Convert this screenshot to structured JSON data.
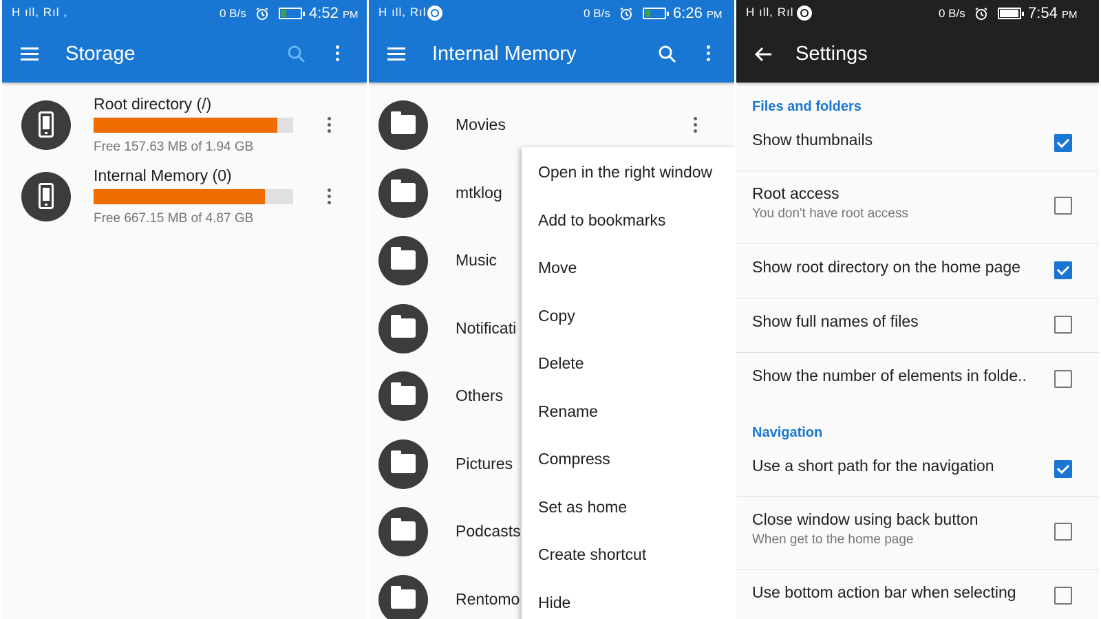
{
  "colors": {
    "primary": "#1976d2",
    "dark_bar": "#212121",
    "progress": "#ef6c00",
    "accent_text": "#1976d2"
  },
  "storage_screen": {
    "status": {
      "signal": "H ıll, Rıl ,",
      "speed": "0 B/s",
      "time": "4:52",
      "ampm": "PM",
      "battery_fraction": 0.25,
      "charging": true
    },
    "title": "Storage",
    "icons": [
      "menu-icon",
      "search-icon",
      "more-vert-icon"
    ],
    "items": [
      {
        "name": "Root directory (/)",
        "used_fraction": 0.92,
        "free_text": "Free 157.63 MB of 1.94 GB",
        "icon": "phone-icon"
      },
      {
        "name": "Internal Memory (0)",
        "used_fraction": 0.86,
        "free_text": "Free 667.15 MB of 4.87 GB",
        "icon": "phone-icon"
      }
    ]
  },
  "internal_screen": {
    "status": {
      "signal": "H ıll, Rıl ,",
      "speed": "0 B/s",
      "time": "6:26",
      "ampm": "PM",
      "battery_fraction": 0.25,
      "charging": true
    },
    "title": "Internal Memory",
    "icons": [
      "menu-icon",
      "search-icon",
      "more-vert-icon"
    ],
    "folders": [
      "Movies",
      "mtklog",
      "Music",
      "Notificati",
      "Others",
      "Pictures",
      "Podcasts",
      "Rentomo"
    ],
    "context_menu": [
      "Open in the right window",
      "Add to bookmarks",
      "Move",
      "Copy",
      "Delete",
      "Rename",
      "Compress",
      "Set as home",
      "Create shortcut",
      "Hide"
    ]
  },
  "settings_screen": {
    "status": {
      "signal": "H ıll, Rıl ,",
      "speed": "0 B/s",
      "time": "7:54",
      "ampm": "PM",
      "battery_fraction": 0.9,
      "charging": false
    },
    "title": "Settings",
    "sections": [
      {
        "header": "Files and folders",
        "items": [
          {
            "title": "Show thumbnails",
            "subtitle": "",
            "checked": true
          },
          {
            "title": "Root access",
            "subtitle": "You don't have root access",
            "checked": false
          },
          {
            "title": "Show root directory on the home page",
            "subtitle": "",
            "checked": true
          },
          {
            "title": "Show full names of files",
            "subtitle": "",
            "checked": false
          },
          {
            "title": "Show the number of elements in folde..",
            "subtitle": "",
            "checked": false
          }
        ]
      },
      {
        "header": "Navigation",
        "items": [
          {
            "title": "Use a short path for the navigation",
            "subtitle": "",
            "checked": true
          },
          {
            "title": "Close window using back button",
            "subtitle": "When get to the home page",
            "checked": false
          },
          {
            "title": "Use bottom action bar when selecting",
            "subtitle": "",
            "checked": false
          }
        ]
      }
    ]
  }
}
